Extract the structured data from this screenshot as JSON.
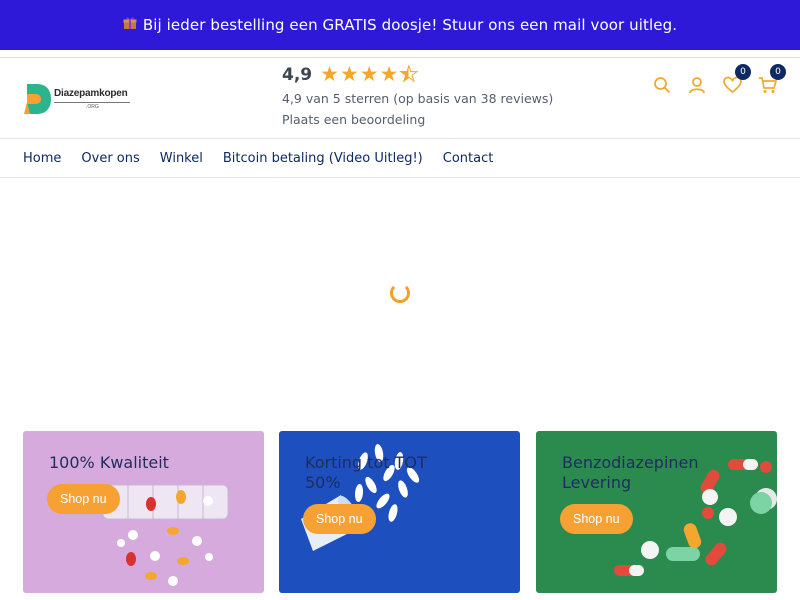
{
  "announcement": {
    "text": "Bij ieder bestelling een GRATIS doosje! Stuur ons een mail voor uitleg.",
    "icon": "gift-icon"
  },
  "logo": {
    "name": "Diazepamkopen",
    "sub": ".ORG"
  },
  "rating": {
    "score": "4,9",
    "stars": 4.5,
    "summary": "4,9 van 5 sterren (op basis van 38 reviews)",
    "review_link": "Plaats een beoordeling"
  },
  "header_icons": {
    "search": "search-icon",
    "account": "user-icon",
    "wishlist": "heart-icon",
    "wishlist_count": "0",
    "cart": "cart-icon",
    "cart_count": "0"
  },
  "nav": {
    "items": [
      "Home",
      "Over ons",
      "Winkel",
      "Bitcoin betaling (Video Uitleg!)",
      "Contact"
    ]
  },
  "promos": [
    {
      "title": "100% Kwaliteit",
      "button": "Shop nu"
    },
    {
      "title": "Korting tot TOT 50%",
      "button": "Shop nu"
    },
    {
      "title": "Benzodiazepinen Levering",
      "button": "Shop nu"
    }
  ],
  "colors": {
    "announcement_bg": "#2f19d8",
    "accent": "#f7a135",
    "nav_text": "#0e2a63",
    "star": "#f2a92a"
  }
}
